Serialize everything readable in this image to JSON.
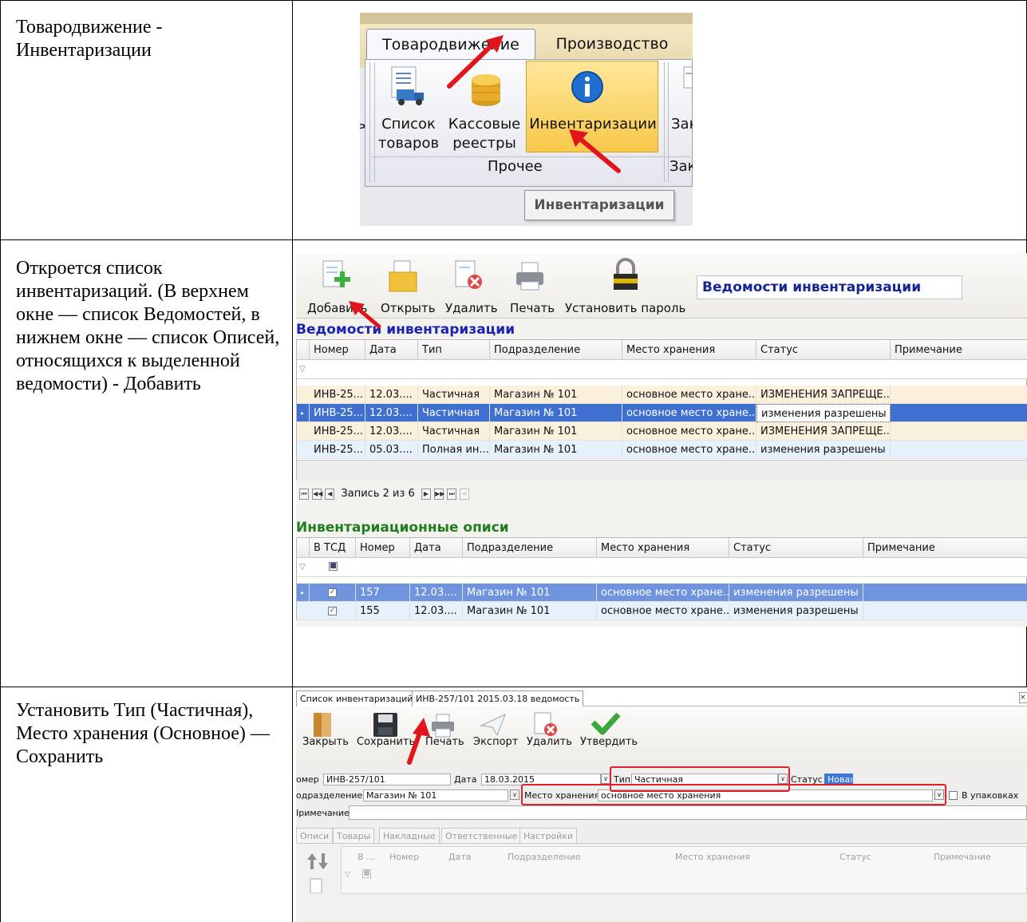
{
  "rows": [
    {
      "text": "Товародвижение - Инвентаризации"
    },
    {
      "text": "Откроется список инвентаризаций. (В верхнем окне — список Ведомостей, в нижнем окне — список Описей, относящихся к выделенной ведомости) - Добавить"
    },
    {
      "text": "Установить Тип (Частичная), Место хранения (Основное) — Сохранить"
    }
  ],
  "shot1": {
    "tabs": [
      "Товародвижение",
      "Производство"
    ],
    "buttons": [
      {
        "label": "Список товаров",
        "icon": "truck-list-icon"
      },
      {
        "label": "Кассовые реестры",
        "icon": "coins-icon"
      },
      {
        "label": "Инвентаризации",
        "icon": "info-icon"
      },
      {
        "label": "Зак",
        "icon": "document-icon"
      }
    ],
    "group_label": "Прочее",
    "group_label_2": "Зак",
    "tooltip": "Инвентаризации"
  },
  "shot2": {
    "toolbar": [
      {
        "label": "Добавить",
        "icon": "add-document-icon"
      },
      {
        "label": "Открыть",
        "icon": "open-folder-icon"
      },
      {
        "label": "Удалить",
        "icon": "delete-document-icon"
      },
      {
        "label": "Печать",
        "icon": "printer-icon"
      },
      {
        "label": "Установить пароль",
        "icon": "lock-icon"
      }
    ],
    "title": "Ведомости инвентаризации",
    "sheets": {
      "title": "Ведомости инвентаризации",
      "columns": [
        "Номер",
        "Дата",
        "Тип",
        "Подразделение",
        "Место хранения",
        "Статус",
        "Примечание"
      ],
      "rows": [
        [
          "ИНВ-25...",
          "12.03....",
          "Частичная",
          "Магазин № 101",
          "основное место хране...",
          "ИЗМЕНЕНИЯ ЗАПРЕЩЕ...",
          ""
        ],
        [
          "ИНВ-25...",
          "12.03....",
          "Частичная",
          "Магазин № 101",
          "основное место хране...",
          "изменения разрешены",
          ""
        ],
        [
          "ИНВ-25...",
          "12.03....",
          "Частичная",
          "Магазин № 101",
          "основное место хране...",
          "ИЗМЕНЕНИЯ ЗАПРЕЩЕ...",
          ""
        ],
        [
          "ИНВ-25...",
          "05.03....",
          "Полная ин...",
          "Магазин № 101",
          "основное место хране...",
          "изменения разрешены",
          ""
        ]
      ],
      "nav": "Запись 2 из 6"
    },
    "inventories": {
      "title": "Инвентариационные описи",
      "columns": [
        "В ТСД",
        "Номер",
        "Дата",
        "Подразделение",
        "Место хранения",
        "Статус",
        "Примечание"
      ],
      "rows": [
        [
          "",
          "157",
          "12.03....",
          "Магазин № 101",
          "основное место хране...",
          "изменения разрешены",
          ""
        ],
        [
          "",
          "155",
          "12.03....",
          "Магазин № 101",
          "основное место хране...",
          "изменения разрешены",
          ""
        ]
      ]
    }
  },
  "shot3": {
    "tabs": [
      "Список инвентаризаций",
      "ИНВ-257/101 2015.03.18 ведомость"
    ],
    "toolbar": [
      {
        "label": "Закрыть",
        "icon": "door-icon"
      },
      {
        "label": "Сохранить",
        "icon": "save-icon"
      },
      {
        "label": "Печать",
        "icon": "printer-icon"
      },
      {
        "label": "Экспорт",
        "icon": "paper-plane-icon"
      },
      {
        "label": "Удалить",
        "icon": "delete-document-icon"
      },
      {
        "label": "Утвердить",
        "icon": "checkmark-icon"
      }
    ],
    "number_label": "омер",
    "number_value": "ИНВ-257/101",
    "date_label": "Дата",
    "date_value": "18.03.2015",
    "type_label": "Тип",
    "type_value": "Частичная",
    "status_label": "Статус",
    "status_value": "Новая",
    "dept_label": "одразделение",
    "dept_value": "Магазин № 101",
    "storage_label": "Место хранения",
    "storage_value": "основное место хранения",
    "pack_label": "В упаковках",
    "note_label": "Iримечание",
    "inner_tabs": [
      "Описи",
      "Товары",
      "Накладные",
      "Ответственные",
      "Настройки"
    ],
    "grid_columns": [
      "В ...",
      "Номер",
      "Дата",
      "Подразделение",
      "Место хранения",
      "Статус",
      "Примечание"
    ]
  },
  "colors": {
    "selection": "#3f6fcf",
    "row_warm": "#fbf0dc",
    "row_cool": "#e7f1fb",
    "section_blue": "#1b24b0",
    "section_green": "#1f7d1f",
    "arrow_red": "#e1151c"
  }
}
